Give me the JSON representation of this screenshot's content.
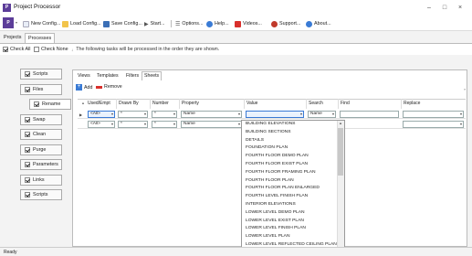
{
  "window": {
    "title": "Project Processor",
    "controls": [
      "–",
      "□",
      "×"
    ]
  },
  "toolbar": {
    "items": [
      {
        "label": "New Config..."
      },
      {
        "label": "Load Config..."
      },
      {
        "label": "Save Config..."
      },
      {
        "label": "Start..."
      },
      {
        "label": "Options..."
      },
      {
        "label": "Help..."
      },
      {
        "label": "Videos..."
      },
      {
        "label": "Support..."
      },
      {
        "label": "About..."
      }
    ]
  },
  "main_tabs": [
    "Projects",
    "Processes"
  ],
  "checkrow": {
    "check_all": "Check All",
    "check_none": "Check None",
    "info": "The following tasks will be processed in the order they are shown."
  },
  "processes": [
    {
      "label": "Scripts",
      "checked": true
    },
    {
      "label": "Files",
      "checked": true
    },
    {
      "label": "Rename",
      "checked": true
    },
    {
      "label": "Swap",
      "checked": true
    },
    {
      "label": "Clean",
      "checked": true
    },
    {
      "label": "Purge",
      "checked": true
    },
    {
      "label": "Parameters",
      "checked": true
    },
    {
      "label": "Links",
      "checked": true
    },
    {
      "label": "Scripts",
      "checked": true
    }
  ],
  "sub_tabs": [
    "Views",
    "Templates",
    "Filters",
    "Sheets"
  ],
  "actions": {
    "add": "Add",
    "remove": "Remove"
  },
  "grid": {
    "headers": [
      "Used/Empt",
      "Drawn By",
      "Number",
      "Property",
      "Value",
      "Search",
      "Find",
      "Replace"
    ],
    "rows": [
      {
        "used": "<All>",
        "drawn_by": "*",
        "number": "*",
        "property": "Name",
        "value": "",
        "search": "Name"
      },
      {
        "used": "<All>",
        "drawn_by": "*",
        "number": "*",
        "property": "Name",
        "value": "",
        "search": ""
      }
    ]
  },
  "dropdown": {
    "options": [
      "BUILDING ELEVATIONS",
      "BUILDING SECTIONS",
      "DETAILS",
      "FOUNDATION PLAN",
      "FOURTH FLOOR DEMO PLAN",
      "FOURTH FLOOR EXIST PLAN",
      "FOURTH FLOOR FRAMING PLAN",
      "FOURTH FLOOR PLAN",
      "FOURTH FLOOR PLAN ENLARGED",
      "FOURTH LEVEL FINISH PLAN",
      "INTERIOR ELEVATIONS",
      "LOWER LEVEL DEMO PLAN",
      "LOWER LEVEL EXIST PLAN",
      "LOWER LEVEL FINISH PLAN",
      "LOWER LEVEL PLAN",
      "LOWER LEVEL REFLECTED CEILING PLAN"
    ]
  },
  "status": {
    "text": "Ready"
  },
  "colors": {
    "accent": "#3a7bd5",
    "brand": "#5c3d99",
    "danger": "#d9302c"
  }
}
